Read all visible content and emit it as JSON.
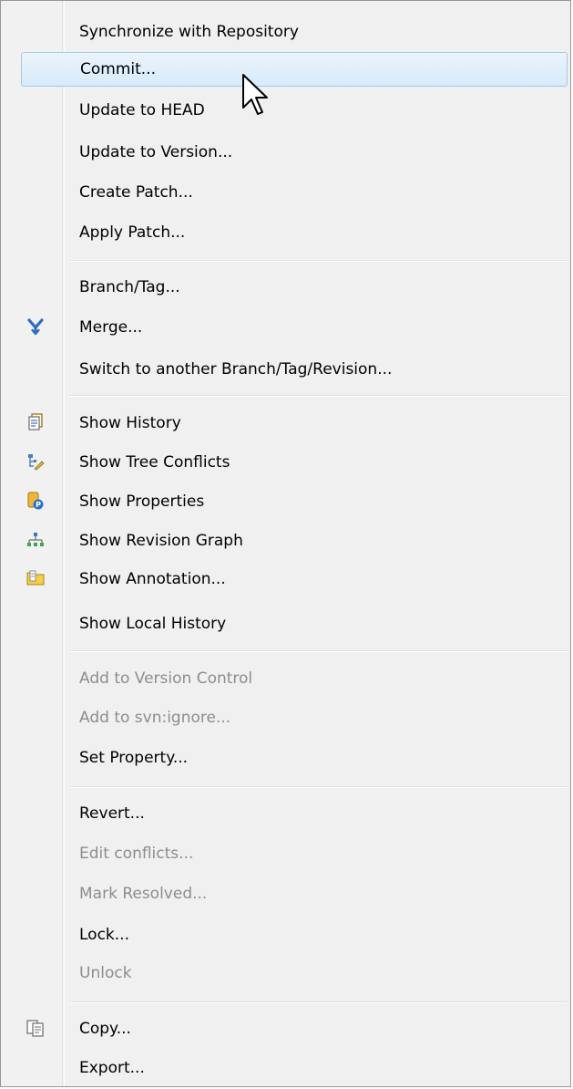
{
  "menu": {
    "groups": [
      {
        "items": [
          {
            "label": "Synchronize with Repository",
            "enabled": true
          },
          {
            "label": "Commit...",
            "enabled": true,
            "hovered": true
          },
          {
            "label": "Update to HEAD",
            "enabled": true
          },
          {
            "label": "Update to Version...",
            "enabled": true
          },
          {
            "label": "Create Patch...",
            "enabled": true
          },
          {
            "label": "Apply Patch...",
            "enabled": true
          }
        ]
      },
      {
        "items": [
          {
            "label": "Branch/Tag...",
            "enabled": true
          },
          {
            "label": "Merge...",
            "enabled": true,
            "icon": "merge-icon"
          },
          {
            "label": "Switch to another Branch/Tag/Revision...",
            "enabled": true
          }
        ]
      },
      {
        "items": [
          {
            "label": "Show History",
            "enabled": true,
            "icon": "history-icon"
          },
          {
            "label": "Show Tree Conflicts",
            "enabled": true,
            "icon": "tree-conflicts-icon"
          },
          {
            "label": "Show Properties",
            "enabled": true,
            "icon": "properties-icon"
          },
          {
            "label": "Show Revision Graph",
            "enabled": true,
            "icon": "revision-graph-icon"
          },
          {
            "label": "Show Annotation...",
            "enabled": true,
            "icon": "annotation-icon"
          },
          {
            "label": "Show Local History",
            "enabled": true
          }
        ]
      },
      {
        "items": [
          {
            "label": "Add to Version Control",
            "enabled": false
          },
          {
            "label": "Add to svn:ignore...",
            "enabled": false
          },
          {
            "label": "Set Property...",
            "enabled": true
          }
        ]
      },
      {
        "items": [
          {
            "label": "Revert...",
            "enabled": true
          },
          {
            "label": "Edit conflicts...",
            "enabled": false
          },
          {
            "label": "Mark Resolved...",
            "enabled": false
          },
          {
            "label": "Lock...",
            "enabled": true
          },
          {
            "label": "Unlock",
            "enabled": false
          }
        ]
      },
      {
        "items": [
          {
            "label": "Copy...",
            "enabled": true,
            "icon": "copy-icon"
          },
          {
            "label": "Export...",
            "enabled": true
          }
        ]
      }
    ]
  },
  "colors": {
    "menu_background": "#f0f0f0",
    "hover_border": "#a5c8e6",
    "disabled_text": "#8d8d8d",
    "merge_icon": "#2a6ebd"
  }
}
